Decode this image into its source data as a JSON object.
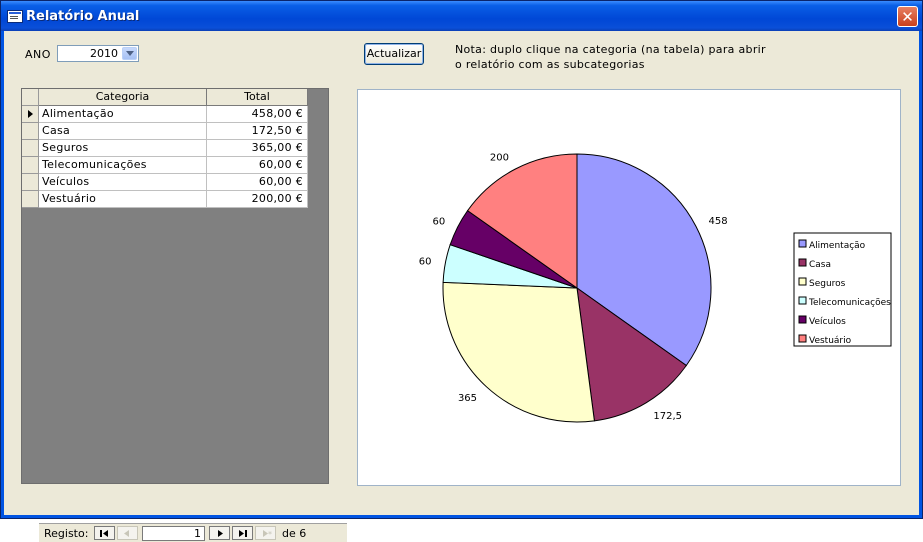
{
  "window": {
    "title": "Relatório Anual",
    "close_label": "✕"
  },
  "filter": {
    "label": "ANO",
    "value": "2010"
  },
  "actions": {
    "refresh_label": "Actualizar"
  },
  "note": "Nota: duplo clique na categoria (na tabela) para abrir o relatório com as subcategorias",
  "table": {
    "headers": {
      "category": "Categoria",
      "total": "Total"
    },
    "rows": [
      {
        "category": "Alimentação",
        "total": "458,00 €"
      },
      {
        "category": "Casa",
        "total": "172,50 €"
      },
      {
        "category": "Seguros",
        "total": "365,00 €"
      },
      {
        "category": "Telecomunicações",
        "total": "60,00 €"
      },
      {
        "category": "Veículos",
        "total": "60,00 €"
      },
      {
        "category": "Vestuário",
        "total": "200,00 €"
      }
    ]
  },
  "navigation": {
    "label": "Registo:",
    "current": "1",
    "of_text": "de 6"
  },
  "chart_data": {
    "type": "pie",
    "categories": [
      "Alimentação",
      "Casa",
      "Seguros",
      "Telecomunicações",
      "Veículos",
      "Vestuário"
    ],
    "values": [
      458,
      172.5,
      365,
      60,
      60,
      200
    ],
    "data_labels": [
      "458",
      "172,5",
      "365",
      "60",
      "60",
      "200"
    ],
    "colors": [
      "#9999ff",
      "#993366",
      "#ffffcc",
      "#ccffff",
      "#660066",
      "#ff8080"
    ],
    "legend_position": "right",
    "title": ""
  }
}
